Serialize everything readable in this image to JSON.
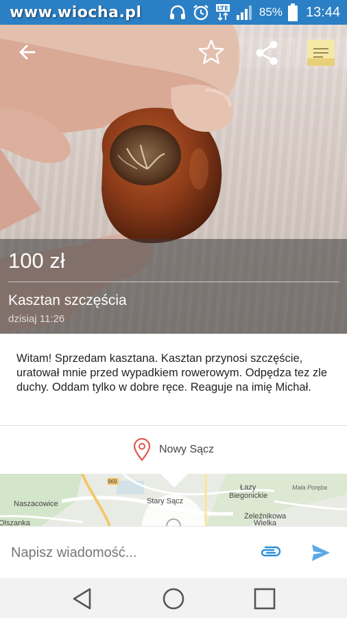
{
  "status_bar": {
    "watermark": "www.wiocha.pl",
    "battery": "85%",
    "time": "13:44",
    "icons": [
      "headphones-icon",
      "alarm-icon",
      "lte-icon",
      "signal-icon",
      "battery-icon"
    ]
  },
  "toolbar": {
    "icons": [
      "back-arrow-icon",
      "star-icon",
      "share-icon",
      "note-icon"
    ]
  },
  "listing": {
    "price": "100 zł",
    "title": "Kasztan szczęścia",
    "date": "dzisiaj 11:26",
    "description": "Witam! Sprzedam kasztana. Kasztan przynosi szczęście, uratował mnie przed wypadkiem rowerowym. Odpędza tez zle duchy. Oddam tylko w dobre ręce. Reaguje na imię Michał.",
    "location": "Nowy Sącz"
  },
  "map": {
    "labels": {
      "road": "969",
      "naszacowice": "Naszacowice",
      "olszanka": "Olszanka",
      "stary_sacz": "Stary Sącz",
      "lazy": "Łazy",
      "biegonickie": "Biegonickie",
      "zeleznikowa": "Żeleźnikowa",
      "wielka": "Wielka",
      "mala_poreba": "Mała Poręba"
    }
  },
  "compose": {
    "placeholder": "Napisz wiadomość..."
  },
  "colors": {
    "status_bar": "#2b7fc4",
    "accent": "#2a8fd6",
    "pin": "#e2554c"
  },
  "nav": {
    "icons": [
      "nav-back-icon",
      "nav-home-icon",
      "nav-recents-icon"
    ]
  }
}
